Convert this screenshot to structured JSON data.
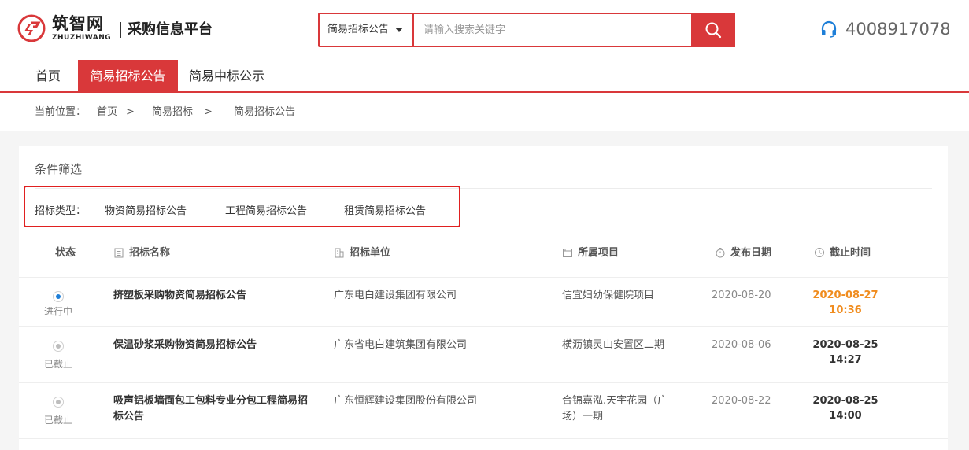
{
  "brand": {
    "name_cn": "筑智网",
    "name_en": "ZHUZHIWANG",
    "platform_title": "采购信息平台",
    "accent_color": "#d9383a"
  },
  "search": {
    "type_selected": "简易招标公告",
    "placeholder": "请输入搜索关键字",
    "button_icon": "search-icon"
  },
  "hotline": {
    "icon": "headset-icon",
    "number": "4008917078",
    "color": "#1e7fd8"
  },
  "nav": {
    "items": [
      {
        "label": "首页",
        "active": false
      },
      {
        "label": "简易招标公告",
        "active": true
      },
      {
        "label": "简易中标公示",
        "active": false
      }
    ]
  },
  "breadcrumb": {
    "prefix": "当前位置：",
    "items": [
      "首页",
      "简易招标",
      "简易招标公告"
    ],
    "separator": ">"
  },
  "filter": {
    "title": "条件筛选",
    "label": "招标类型：",
    "options": [
      "物资简易招标公告",
      "工程简易招标公告",
      "租赁简易招标公告"
    ]
  },
  "table": {
    "headers": {
      "status": "状态",
      "name": "招标名称",
      "unit": "招标单位",
      "project": "所属项目",
      "publish_date": "发布日期",
      "deadline": "截止时间"
    },
    "rows": [
      {
        "status": "进行中",
        "active": true,
        "name": "挤塑板采购物资简易招标公告",
        "unit": "广东电白建设集团有限公司",
        "project": "信宜妇幼保健院项目",
        "publish_date": "2020-08-20",
        "deadline_date": "2020-08-27",
        "deadline_time": "10:36"
      },
      {
        "status": "已截止",
        "active": false,
        "name": "保温砂浆采购物资简易招标公告",
        "unit": "广东省电白建筑集团有限公司",
        "project": "横沥镇灵山安置区二期",
        "publish_date": "2020-08-06",
        "deadline_date": "2020-08-25",
        "deadline_time": "14:27"
      },
      {
        "status": "已截止",
        "active": false,
        "name": "吸声铝板墙面包工包料专业分包工程简易招标公告",
        "unit": "广东恒辉建设集团股份有限公司",
        "project": "合锦嘉泓.天宇花园（广场）一期",
        "publish_date": "2020-08-22",
        "deadline_date": "2020-08-25",
        "deadline_time": "14:00"
      }
    ],
    "active_deadline_color": "#f08c1e",
    "active_status_color": "#1e7fd8"
  }
}
